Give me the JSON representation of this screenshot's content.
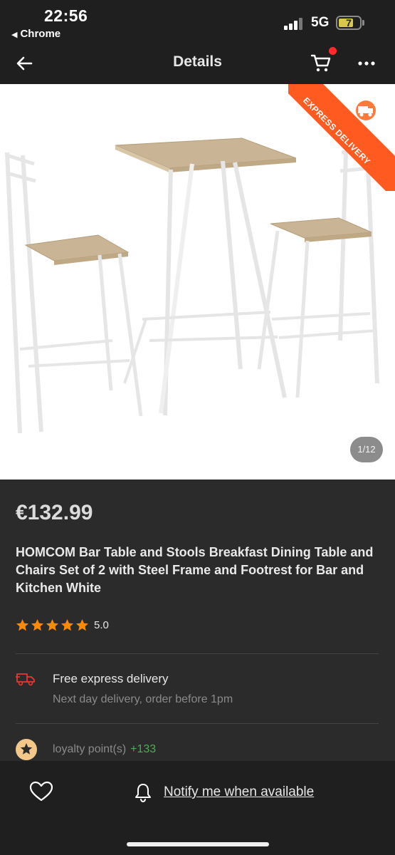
{
  "status_bar": {
    "time": "22:56",
    "back_app": "Chrome",
    "network": "5G",
    "battery": "7"
  },
  "nav": {
    "title": "Details",
    "cart_badge_color": "#ff2a2a"
  },
  "image": {
    "ribbon_text": "EXPRESS DELIVERY",
    "counter": "1/12"
  },
  "product": {
    "price": "€132.99",
    "title": "HOMCOM Bar Table and Stools Breakfast Dining Table and Chairs Set of 2 with Steel Frame and Footrest for Bar and Kitchen White",
    "rating": "5.0",
    "stars": 5,
    "star_color": "#ff8a00"
  },
  "delivery": {
    "title": "Free express delivery",
    "subtitle": "Next day delivery, order before 1pm"
  },
  "loyalty": {
    "label": "loyalty point(s)",
    "points": "+133"
  },
  "bottom_bar": {
    "notify_label": "Notify me when available"
  }
}
